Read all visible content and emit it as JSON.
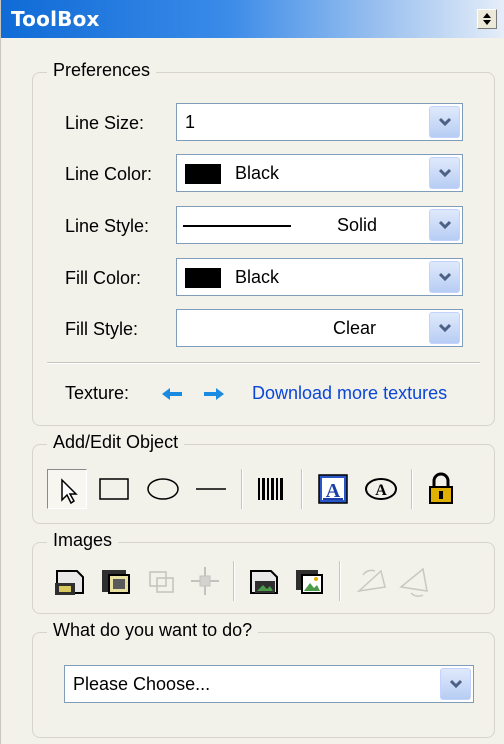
{
  "window": {
    "title": "ToolBox"
  },
  "preferences": {
    "legend": "Preferences",
    "line_size": {
      "label": "Line Size:",
      "value": "1"
    },
    "line_color": {
      "label": "Line Color:",
      "value": "Black",
      "swatch": "#000000"
    },
    "line_style": {
      "label": "Line Style:",
      "value": "Solid"
    },
    "fill_color": {
      "label": "Fill Color:",
      "value": "Black",
      "swatch": "#000000"
    },
    "fill_style": {
      "label": "Fill Style:",
      "value": "Clear"
    },
    "texture": {
      "label": "Texture:",
      "link": "Download more textures"
    }
  },
  "add_edit": {
    "legend": "Add/Edit Object",
    "tools": [
      "pointer-icon",
      "rectangle-icon",
      "ellipse-icon",
      "line-icon",
      "barcode-icon",
      "text-frame-icon",
      "text-circle-icon",
      "lock-icon"
    ]
  },
  "images": {
    "legend": "Images",
    "tools": [
      "image-insert-icon",
      "image-replace-icon",
      "image-crop-icon",
      "image-move-icon",
      "image-front-icon",
      "image-back-icon",
      "rotate-left-icon",
      "rotate-right-icon"
    ]
  },
  "task": {
    "legend": "What do you want to do?",
    "value": "Please Choose..."
  },
  "colors": {
    "title_start": "#0f6bd6",
    "title_end": "#e6eef9",
    "panel_bg": "#f2f1ea",
    "link": "#0a46d8",
    "arrow_blue": "#1a8be0"
  }
}
